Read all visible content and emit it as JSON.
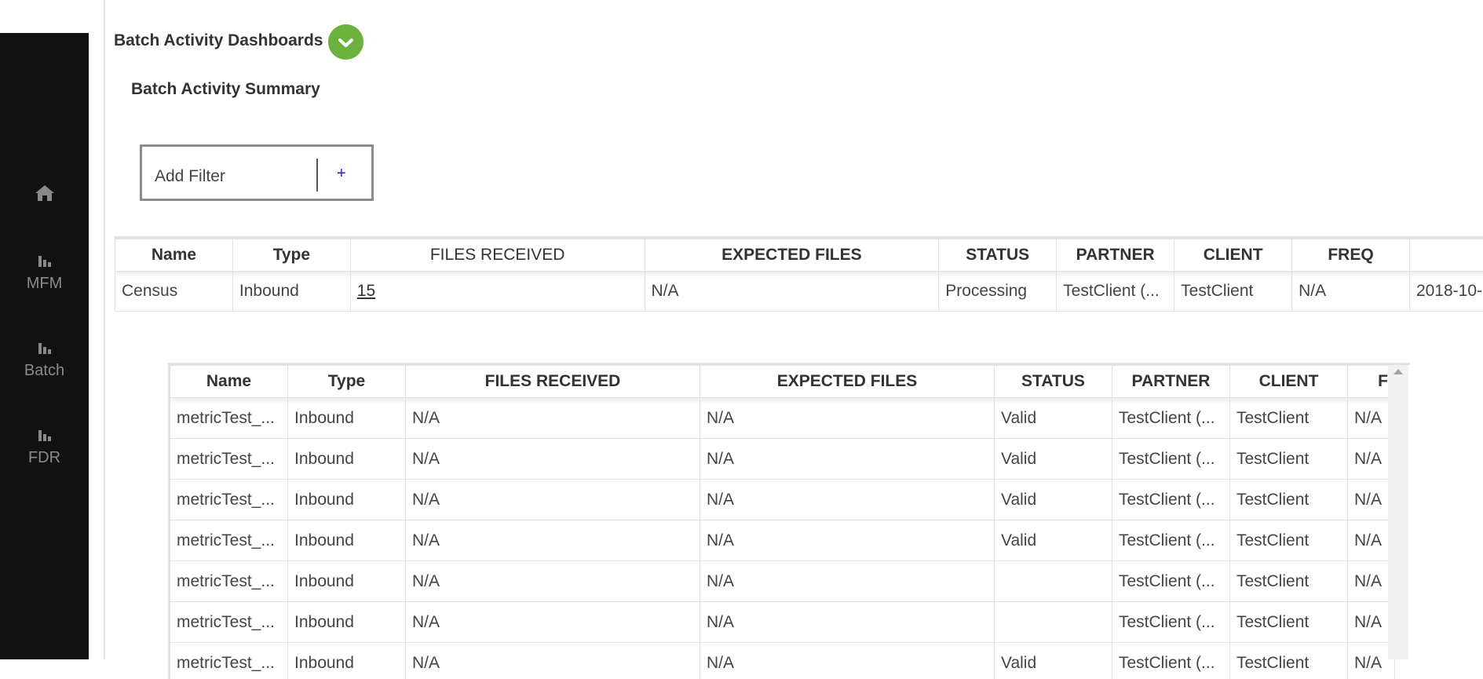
{
  "header": {
    "title": "Batch Activity Dashboards",
    "subtitle": "Batch Activity Summary"
  },
  "sidebar": {
    "items": [
      {
        "icon": "home-icon",
        "label": ""
      },
      {
        "icon": "bar-chart-icon",
        "label": "MFM"
      },
      {
        "icon": "bar-chart-icon",
        "label": "Batch"
      },
      {
        "icon": "bar-chart-icon",
        "label": "FDR"
      }
    ]
  },
  "filter": {
    "label": "Add Filter",
    "add": "+"
  },
  "outer_table": {
    "columns": [
      "Name",
      "Type",
      "FILES RECEIVED",
      "EXPECTED FILES",
      "STATUS",
      "PARTNER",
      "CLIENT",
      "FREQ",
      ""
    ],
    "row": {
      "name": "Census",
      "type": "Inbound",
      "files_received": "15",
      "expected_files": "N/A",
      "status": "Processing",
      "partner": "TestClient (...",
      "client": "TestClient",
      "freq": "N/A",
      "date": "2018-10-"
    }
  },
  "inner_table": {
    "columns": [
      "Name",
      "Type",
      "FILES RECEIVED",
      "EXPECTED FILES",
      "STATUS",
      "PARTNER",
      "CLIENT",
      "F"
    ],
    "rows": [
      {
        "name": "metricTest_...",
        "type": "Inbound",
        "files_received": "N/A",
        "expected_files": "N/A",
        "status": "Valid",
        "partner": "TestClient (...",
        "client": "TestClient",
        "freq": "N/A"
      },
      {
        "name": "metricTest_...",
        "type": "Inbound",
        "files_received": "N/A",
        "expected_files": "N/A",
        "status": "Valid",
        "partner": "TestClient (...",
        "client": "TestClient",
        "freq": "N/A"
      },
      {
        "name": "metricTest_...",
        "type": "Inbound",
        "files_received": "N/A",
        "expected_files": "N/A",
        "status": "Valid",
        "partner": "TestClient (...",
        "client": "TestClient",
        "freq": "N/A"
      },
      {
        "name": "metricTest_...",
        "type": "Inbound",
        "files_received": "N/A",
        "expected_files": "N/A",
        "status": "Valid",
        "partner": "TestClient (...",
        "client": "TestClient",
        "freq": "N/A"
      },
      {
        "name": "metricTest_...",
        "type": "Inbound",
        "files_received": "N/A",
        "expected_files": "N/A",
        "status": "",
        "partner": "TestClient (...",
        "client": "TestClient",
        "freq": "N/A"
      },
      {
        "name": "metricTest_...",
        "type": "Inbound",
        "files_received": "N/A",
        "expected_files": "N/A",
        "status": "",
        "partner": "TestClient (...",
        "client": "TestClient",
        "freq": "N/A"
      },
      {
        "name": "metricTest_...",
        "type": "Inbound",
        "files_received": "N/A",
        "expected_files": "N/A",
        "status": "Valid",
        "partner": "TestClient (...",
        "client": "TestClient",
        "freq": "N/A"
      }
    ]
  },
  "colors": {
    "sidebar_bg": "#121212",
    "accent_green": "#6ab23c",
    "add_link": "#1a1af0"
  }
}
